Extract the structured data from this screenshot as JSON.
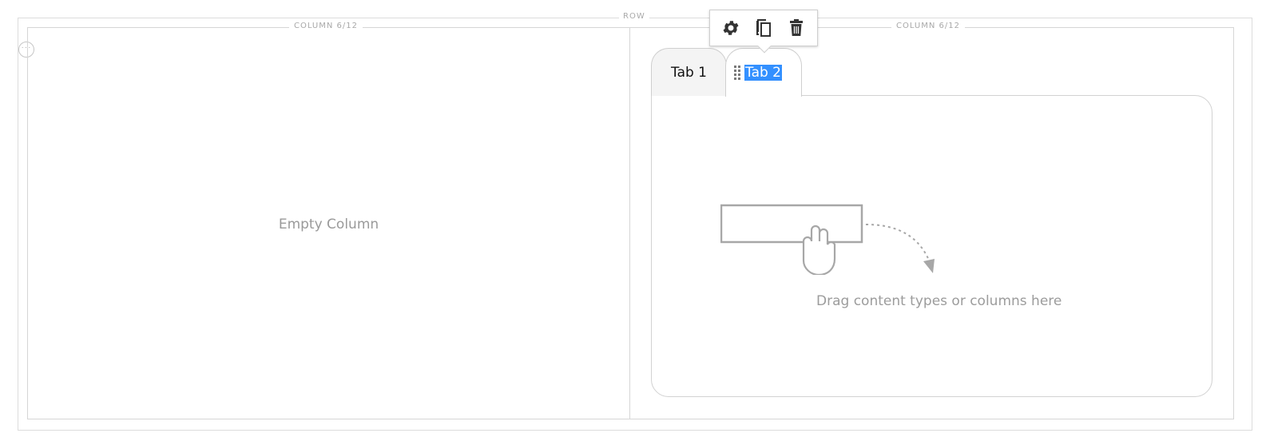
{
  "row": {
    "label": "ROW"
  },
  "columns": [
    {
      "label": "COLUMN 6/12",
      "empty_text": "Empty Column"
    },
    {
      "label": "COLUMN 6/12"
    }
  ],
  "toolbar": {
    "items": [
      {
        "icon": "gear-icon"
      },
      {
        "icon": "copy-icon"
      },
      {
        "icon": "trash-icon"
      }
    ]
  },
  "tabs": {
    "items": [
      {
        "label": "Tab 1",
        "active": false
      },
      {
        "label": "Tab 2",
        "active": true,
        "selected_text": true
      }
    ],
    "panel": {
      "placeholder": "Drag content types or columns here",
      "illustration_icon": "hand-drag-icon"
    }
  },
  "colors": {
    "border": "#d6d6d6",
    "label_gray": "#a8a8a8",
    "selection": "#3390ff",
    "icon_dark": "#333333"
  }
}
